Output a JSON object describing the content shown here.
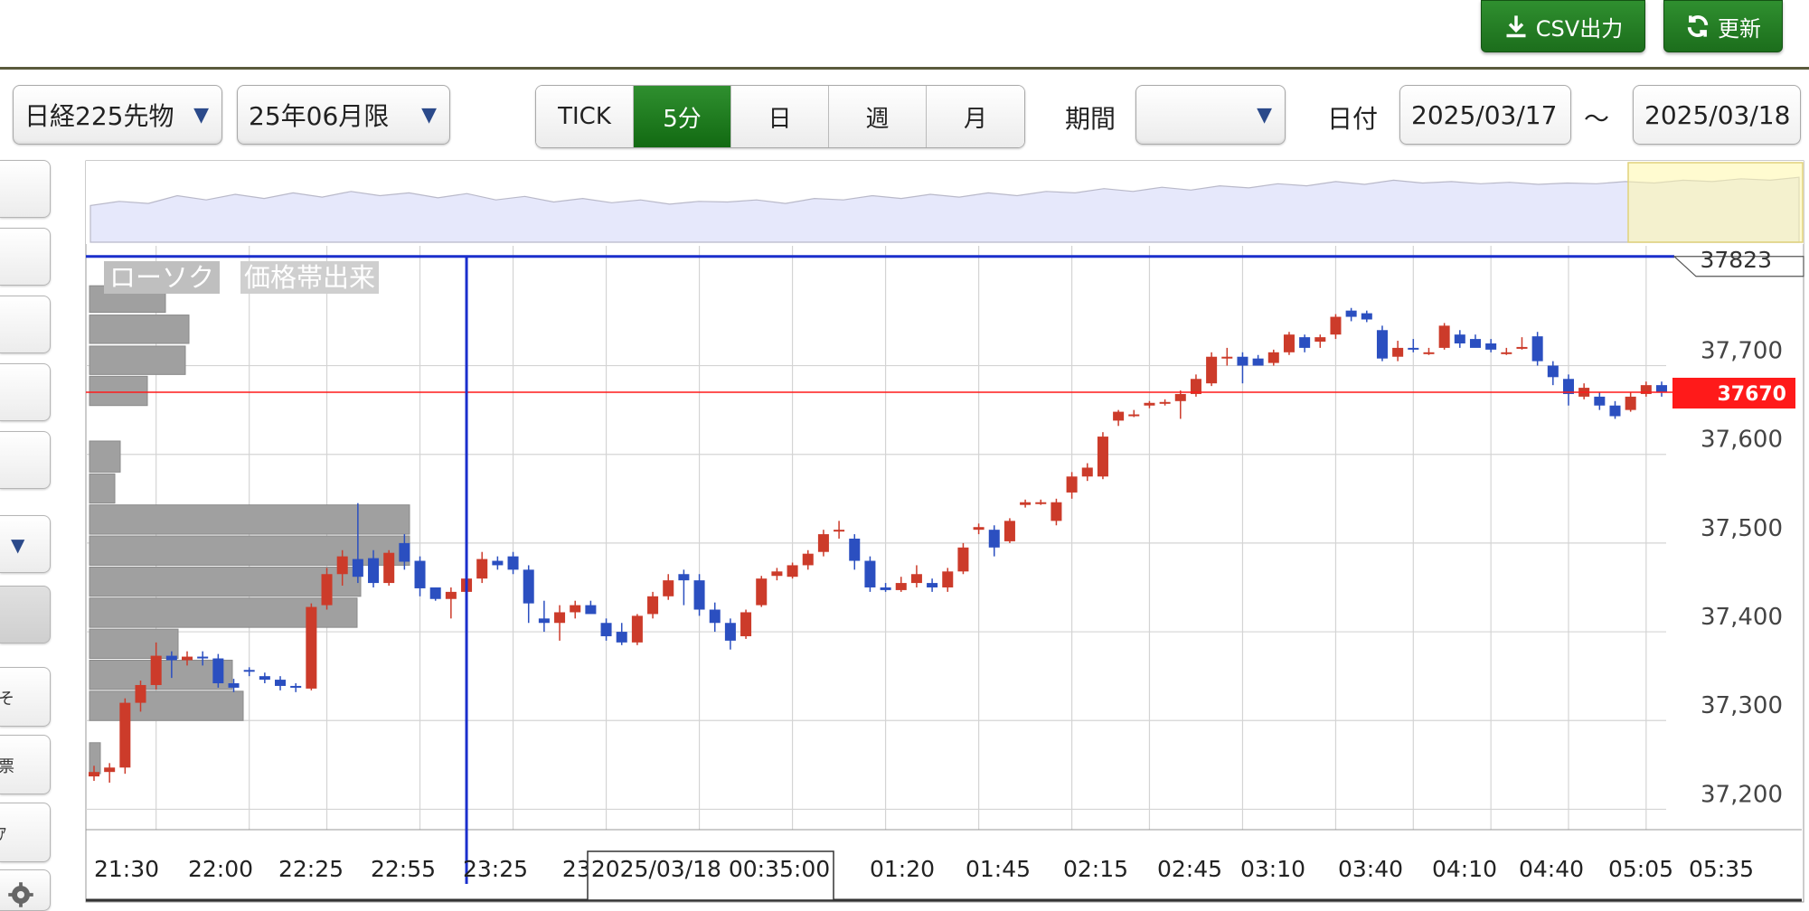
{
  "toolbar": {
    "csv_label": "CSV出力",
    "refresh_label": "更新",
    "instrument": "日経225先物",
    "contract_month": "25年06月限",
    "intervals": [
      "TICK",
      "5分",
      "日",
      "週",
      "月"
    ],
    "active_interval": "5分",
    "period_label": "期間",
    "period_value": "",
    "date_label": "日付",
    "date_from": "2025/03/17",
    "date_sep": "〜",
    "date_to": "2025/03/18"
  },
  "sidebar": {
    "fragments": [
      "そ",
      "票",
      "ｱ"
    ]
  },
  "colors": {
    "up": "#cc3b2a",
    "down": "#2b4fc0",
    "accent": "#1f7a1f",
    "price_tag": "#ff1a1a",
    "crosshair": "#1a2fcc"
  },
  "chart_data": {
    "type": "candlestick",
    "badges": [
      "ローソク",
      "価格帯出来"
    ],
    "x_tick_labels": [
      "21:30",
      "22:00",
      "22:25",
      "22:55",
      "23:25",
      "23:5",
      "01:20",
      "01:45",
      "02:15",
      "02:45",
      "03:10",
      "03:40",
      "04:10",
      "04:40",
      "05:05",
      "05:35"
    ],
    "y_tick_labels": [
      "37,700",
      "37,600",
      "37,500",
      "37,400",
      "37,300",
      "37,200"
    ],
    "y_ticks": [
      37700,
      37600,
      37500,
      37400,
      37300,
      37200
    ],
    "ylim": [
      37177,
      37835
    ],
    "current_price": 37670,
    "current_price_label": "37670",
    "crosshair_label": "2025/03/18 00:35:00",
    "crosshair_value_label": "37823",
    "crosshair_value": 37823,
    "crosshair_index": 24,
    "candles": [
      [
        37237,
        37242,
        37232,
        37249
      ],
      [
        37242,
        37247,
        37230,
        37252
      ],
      [
        37247,
        37320,
        37240,
        37325
      ],
      [
        37320,
        37340,
        37310,
        37345
      ],
      [
        37340,
        37373,
        37335,
        37388
      ],
      [
        37373,
        37368,
        37348,
        37378
      ],
      [
        37368,
        37372,
        37362,
        37378
      ],
      [
        37372,
        37370,
        37362,
        37378
      ],
      [
        37370,
        37342,
        37337,
        37375
      ],
      [
        37342,
        37337,
        37332,
        37347
      ],
      [
        37357,
        37355,
        37350,
        37360
      ],
      [
        37350,
        37346,
        37342,
        37354
      ],
      [
        37346,
        37339,
        37334,
        37350
      ],
      [
        37339,
        37337,
        37332,
        37342
      ],
      [
        37336,
        37428,
        37334,
        37432
      ],
      [
        37430,
        37465,
        37425,
        37472
      ],
      [
        37465,
        37485,
        37452,
        37492
      ],
      [
        37482,
        37462,
        37455,
        37545
      ],
      [
        37483,
        37455,
        37450,
        37492
      ],
      [
        37455,
        37489,
        37452,
        37492
      ],
      [
        37500,
        37479,
        37470,
        37510
      ],
      [
        37480,
        37449,
        37440,
        37485
      ],
      [
        37450,
        37437,
        37435,
        37450
      ],
      [
        37437,
        37445,
        37415,
        37450
      ],
      [
        37445,
        37460,
        37440,
        37465
      ],
      [
        37460,
        37482,
        37455,
        37490
      ],
      [
        37480,
        37475,
        37470,
        37485
      ],
      [
        37485,
        37470,
        37465,
        37490
      ],
      [
        37470,
        37432,
        37410,
        37475
      ],
      [
        37415,
        37410,
        37400,
        37435
      ],
      [
        37410,
        37422,
        37390,
        37430
      ],
      [
        37422,
        37430,
        37415,
        37435
      ],
      [
        37430,
        37420,
        37425,
        37435
      ],
      [
        37410,
        37395,
        37390,
        37415
      ],
      [
        37400,
        37388,
        37385,
        37410
      ],
      [
        37388,
        37418,
        37385,
        37420
      ],
      [
        37420,
        37440,
        37415,
        37445
      ],
      [
        37440,
        37458,
        37436,
        37465
      ],
      [
        37465,
        37458,
        37430,
        37470
      ],
      [
        37458,
        37425,
        37418,
        37465
      ],
      [
        37425,
        37410,
        37400,
        37433
      ],
      [
        37410,
        37390,
        37380,
        37415
      ],
      [
        37395,
        37422,
        37392,
        37425
      ],
      [
        37430,
        37460,
        37428,
        37463
      ],
      [
        37463,
        37468,
        37458,
        37472
      ],
      [
        37462,
        37475,
        37460,
        37478
      ],
      [
        37475,
        37488,
        37470,
        37492
      ],
      [
        37490,
        37510,
        37485,
        37515
      ],
      [
        37515,
        37515,
        37505,
        37525
      ],
      [
        37505,
        37480,
        37470,
        37510
      ],
      [
        37480,
        37450,
        37445,
        37485
      ],
      [
        37450,
        37447,
        37445,
        37455
      ],
      [
        37447,
        37455,
        37445,
        37462
      ],
      [
        37455,
        37465,
        37450,
        37475
      ],
      [
        37455,
        37450,
        37445,
        37460
      ],
      [
        37450,
        37468,
        37445,
        37472
      ],
      [
        37468,
        37495,
        37465,
        37500
      ],
      [
        37515,
        37518,
        37510,
        37522
      ],
      [
        37515,
        37495,
        37485,
        37520
      ],
      [
        37502,
        37525,
        37500,
        37528
      ],
      [
        37543,
        37546,
        37540,
        37549
      ],
      [
        37546,
        37546,
        37543,
        37549
      ],
      [
        37525,
        37546,
        37520,
        37550
      ],
      [
        37557,
        37575,
        37550,
        37580
      ],
      [
        37575,
        37585,
        37570,
        37590
      ],
      [
        37575,
        37620,
        37572,
        37625
      ],
      [
        37638,
        37648,
        37632,
        37650
      ],
      [
        37645,
        37645,
        37642,
        37650
      ],
      [
        37655,
        37658,
        37652,
        37660
      ],
      [
        37658,
        37659,
        37655,
        37662
      ],
      [
        37660,
        37668,
        37640,
        37672
      ],
      [
        37668,
        37685,
        37665,
        37690
      ],
      [
        37680,
        37710,
        37677,
        37715
      ],
      [
        37708,
        37710,
        37700,
        37720
      ],
      [
        37710,
        37700,
        37680,
        37715
      ],
      [
        37708,
        37700,
        37705,
        37712
      ],
      [
        37703,
        37715,
        37700,
        37718
      ],
      [
        37715,
        37735,
        37712,
        37738
      ],
      [
        37732,
        37720,
        37715,
        37735
      ],
      [
        37727,
        37732,
        37720,
        37735
      ],
      [
        37735,
        37755,
        37730,
        37758
      ],
      [
        37762,
        37755,
        37750,
        37765
      ],
      [
        37759,
        37752,
        37749,
        37762
      ],
      [
        37740,
        37708,
        37705,
        37745
      ],
      [
        37710,
        37720,
        37705,
        37728
      ],
      [
        37720,
        37718,
        37715,
        37730
      ],
      [
        37715,
        37715,
        37712,
        37720
      ],
      [
        37720,
        37745,
        37718,
        37748
      ],
      [
        37735,
        37725,
        37720,
        37740
      ],
      [
        37730,
        37720,
        37725,
        37735
      ],
      [
        37725,
        37718,
        37715,
        37730
      ],
      [
        37715,
        37715,
        37712,
        37720
      ],
      [
        37720,
        37721,
        37718,
        37732
      ],
      [
        37733,
        37705,
        37700,
        37738
      ],
      [
        37700,
        37687,
        37678,
        37705
      ],
      [
        37685,
        37668,
        37655,
        37690
      ],
      [
        37665,
        37675,
        37662,
        37680
      ],
      [
        37665,
        37655,
        37650,
        37670
      ],
      [
        37655,
        37643,
        37640,
        37660
      ],
      [
        37650,
        37665,
        37648,
        37670
      ],
      [
        37668,
        37678,
        37665,
        37682
      ],
      [
        37678,
        37670,
        37665,
        37682
      ]
    ],
    "volume_profile": [
      {
        "y_top": 37790,
        "y_bottom": 37760,
        "width": 84
      },
      {
        "y_top": 37757,
        "y_bottom": 37725,
        "width": 110
      },
      {
        "y_top": 37722,
        "y_bottom": 37690,
        "width": 106
      },
      {
        "y_top": 37688,
        "y_bottom": 37655,
        "width": 64
      },
      {
        "y_top": 37615,
        "y_bottom": 37580,
        "width": 34
      },
      {
        "y_top": 37578,
        "y_bottom": 37545,
        "width": 28
      },
      {
        "y_top": 37543,
        "y_bottom": 37510,
        "width": 354
      },
      {
        "y_top": 37508,
        "y_bottom": 37475,
        "width": 354
      },
      {
        "y_top": 37473,
        "y_bottom": 37440,
        "width": 300
      },
      {
        "y_top": 37438,
        "y_bottom": 37405,
        "width": 296
      },
      {
        "y_top": 37403,
        "y_bottom": 37370,
        "width": 98
      },
      {
        "y_top": 37368,
        "y_bottom": 37335,
        "width": 158
      },
      {
        "y_top": 37333,
        "y_bottom": 37300,
        "width": 170
      },
      {
        "y_top": 37275,
        "y_bottom": 37240,
        "width": 12
      }
    ],
    "overview_series": [
      0.52,
      0.58,
      0.55,
      0.66,
      0.6,
      0.68,
      0.62,
      0.7,
      0.64,
      0.72,
      0.66,
      0.7,
      0.63,
      0.69,
      0.6,
      0.65,
      0.57,
      0.62,
      0.56,
      0.6,
      0.54,
      0.58,
      0.57,
      0.6,
      0.55,
      0.62,
      0.6,
      0.66,
      0.62,
      0.68,
      0.64,
      0.7,
      0.66,
      0.72,
      0.7,
      0.76,
      0.72,
      0.78,
      0.74,
      0.8,
      0.77,
      0.83,
      0.8,
      0.86,
      0.82,
      0.88,
      0.84,
      0.86,
      0.83,
      0.85,
      0.82,
      0.84,
      0.83,
      0.86,
      0.84,
      0.88,
      0.86,
      0.9,
      0.88,
      0.92
    ],
    "overview_window": [
      0.9,
      1.0
    ]
  }
}
